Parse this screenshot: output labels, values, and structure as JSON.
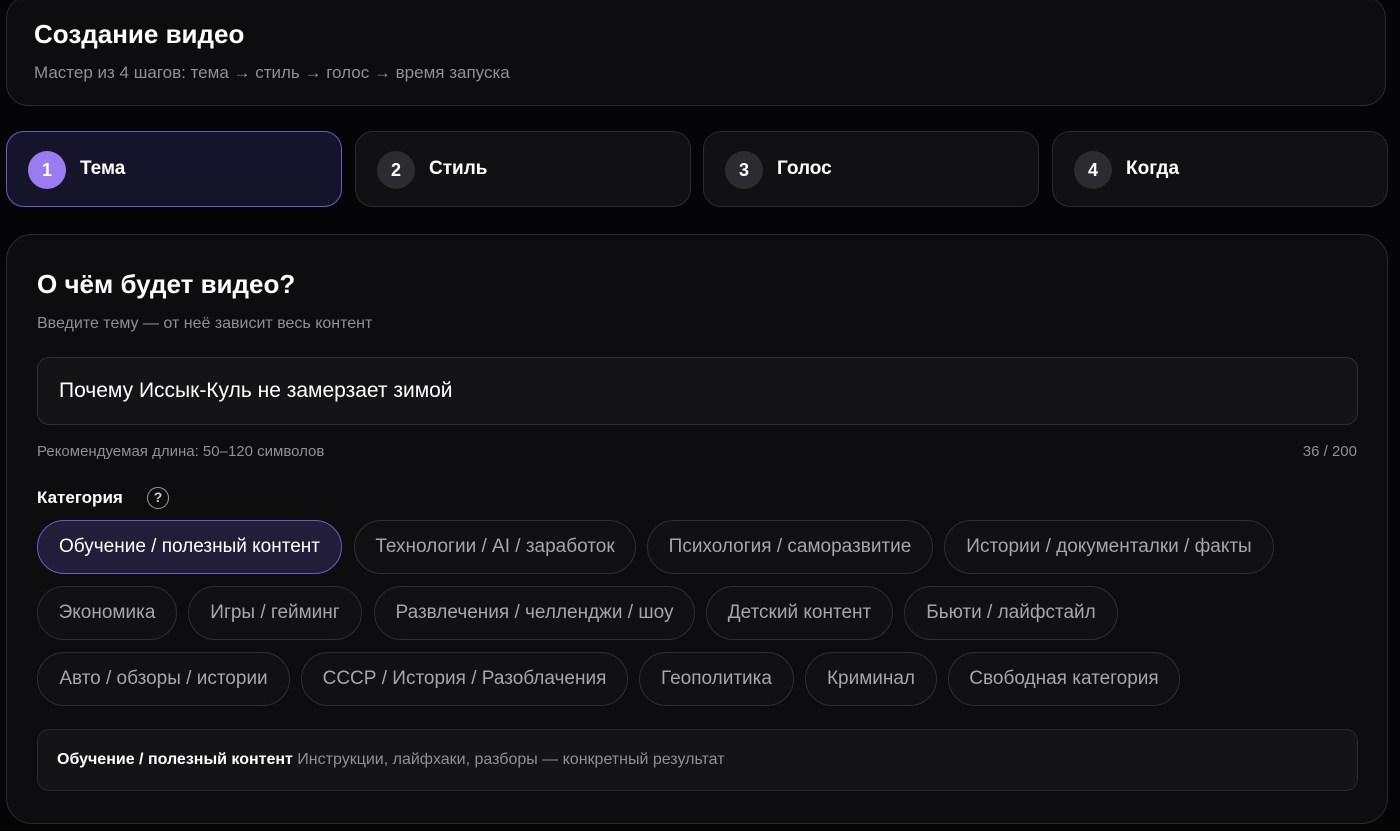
{
  "header": {
    "title": "Создание видео",
    "subtitle": "Мастер из 4 шагов: тема → стиль → голос → время запуска"
  },
  "steps": [
    {
      "num": "1",
      "label": "Тема",
      "active": true
    },
    {
      "num": "2",
      "label": "Стиль",
      "active": false
    },
    {
      "num": "3",
      "label": "Голос",
      "active": false
    },
    {
      "num": "4",
      "label": "Когда",
      "active": false
    }
  ],
  "topic": {
    "title": "О чём будет видео?",
    "subtitle": "Введите тему — от неё зависит весь контент",
    "input_value": "Почему Иссык-Куль не замерзает зимой",
    "hint": "Рекомендуемая длина: 50–120 символов",
    "counter": "36 / 200"
  },
  "category": {
    "label": "Категория",
    "help_symbol": "?",
    "rows": [
      [
        "Обучение / полезный контент",
        "Технологии / AI / заработок",
        "Психология / саморазвитие",
        "Истории / документалки / факты"
      ],
      [
        "Экономика",
        "Игры / гейминг",
        "Развлечения / челленджи / шоу",
        "Детский контент",
        "Бьюти / лайфстайл"
      ],
      [
        "Авто / обзоры / истории",
        "СССР / История / Разоблачения",
        "Геополитика",
        "Криминал",
        "Свободная категория"
      ]
    ],
    "selected": "Обучение / полезный контент",
    "description": {
      "name": "Обучение / полезный контент",
      "text": " Инструкции, лайфхаки, разборы — конкретный результат"
    }
  },
  "colors": {
    "accent": "#9b7bf0",
    "accent_border": "#6b5bc8",
    "background": "#050507",
    "card": "#0d0d0f"
  }
}
